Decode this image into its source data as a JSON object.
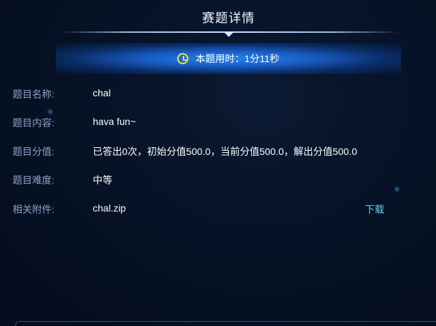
{
  "header": {
    "title": "赛题详情"
  },
  "timer": {
    "text": "本题用时：1分11秒",
    "icon": "clock-icon",
    "icon_color": "#f4e64a",
    "bar_color": "#2a86ee"
  },
  "details": [
    {
      "label": "题目名称:",
      "value": "chal"
    },
    {
      "label": "题目内容:",
      "value": "hava fun~"
    },
    {
      "label": "题目分值:",
      "value": "已答出0次，初始分值500.0，当前分值500.0，解出分值500.0"
    },
    {
      "label": "题目难度:",
      "value": "中等"
    },
    {
      "label": "相关附件:",
      "value": "chal.zip",
      "action": "下载"
    }
  ],
  "colors": {
    "background": "#061226",
    "label": "#8aa3c9",
    "value": "#ffffff",
    "link": "#52d6f0"
  }
}
